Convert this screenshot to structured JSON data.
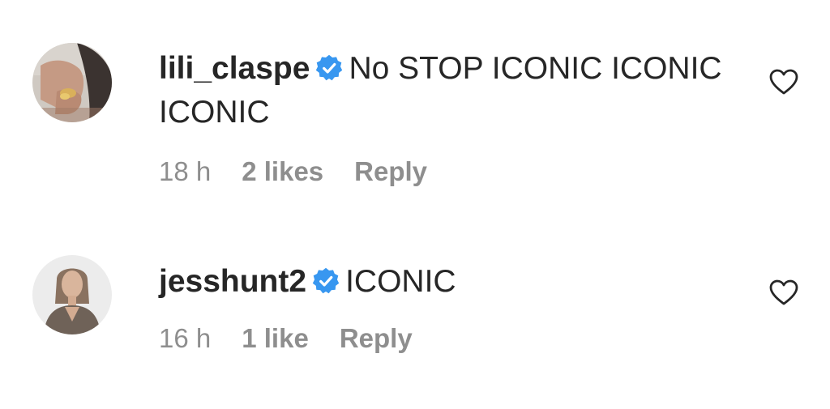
{
  "comments": [
    {
      "username": "lili_claspe",
      "verified": true,
      "text": "No STOP ICONIC ICONIC ICONIC",
      "time": "18 h",
      "likes": "2 likes",
      "reply_label": "Reply",
      "like_icon": "heart-outline-icon"
    },
    {
      "username": "jesshunt2",
      "verified": true,
      "text": "ICONIC",
      "time": "16 h",
      "likes": "1 like",
      "reply_label": "Reply",
      "like_icon": "heart-outline-icon"
    }
  ],
  "colors": {
    "text": "#262626",
    "secondary": "#8e8e8e",
    "verified_badge": "#3897f0"
  }
}
